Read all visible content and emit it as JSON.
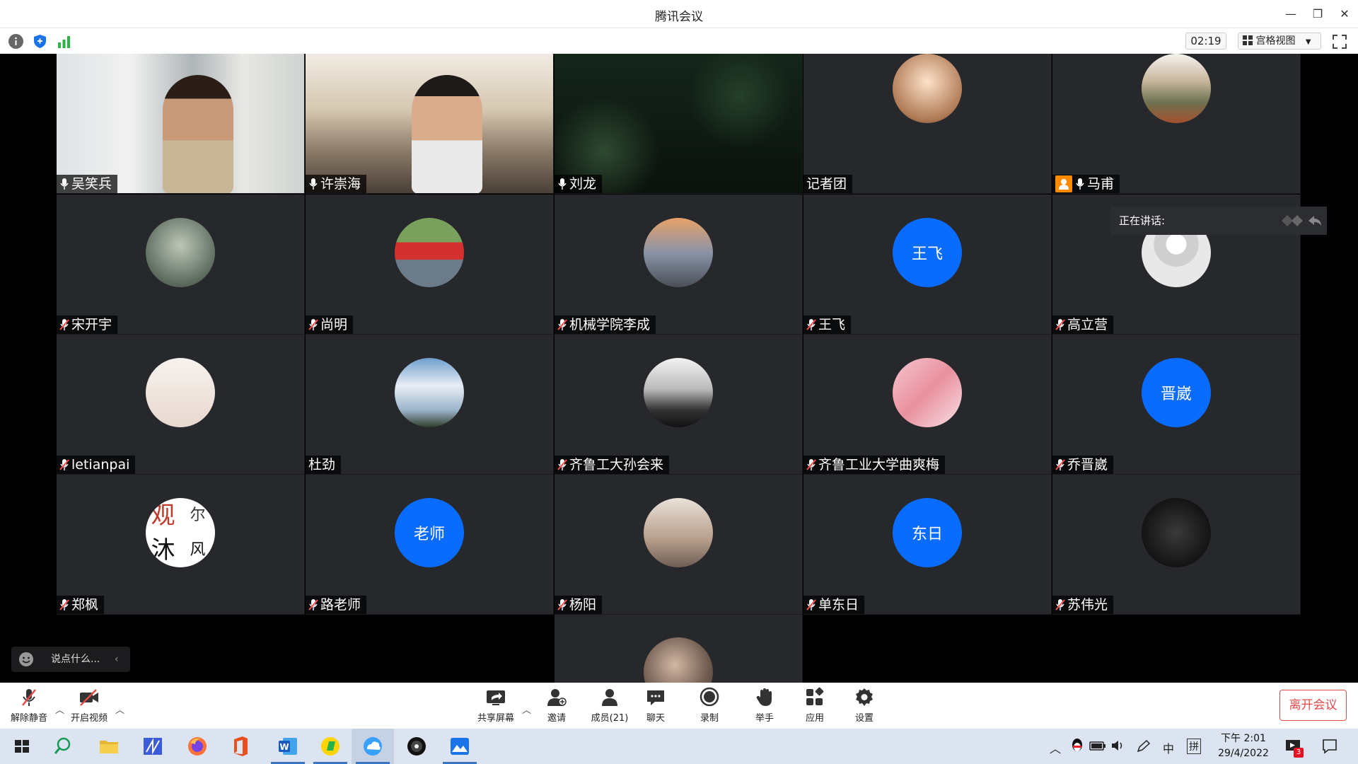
{
  "window": {
    "title": "腾讯会议",
    "minimize_glyph": "—",
    "restore_glyph": "❐",
    "close_glyph": "✕"
  },
  "topbar": {
    "timer": "02:19",
    "view_label": "宫格视图",
    "icons": [
      "info-icon",
      "shield-icon",
      "signal-icon",
      "grid-icon",
      "fullscreen-icon"
    ]
  },
  "participants": [
    {
      "name": "吴笑兵",
      "mic": "on"
    },
    {
      "name": "许崇海",
      "mic": "on"
    },
    {
      "name": "刘龙",
      "mic": "on"
    },
    {
      "name": "记者团",
      "mic": "none"
    },
    {
      "name": "马甫",
      "mic": "on",
      "host": true
    },
    {
      "name": "宋开宇",
      "mic": "muted"
    },
    {
      "name": "尚明",
      "mic": "muted"
    },
    {
      "name": "机械学院李成",
      "mic": "muted"
    },
    {
      "name": "王飞",
      "mic": "muted",
      "avatar_text": "王飞"
    },
    {
      "name": "高立营",
      "mic": "muted"
    },
    {
      "name": "letianpai",
      "mic": "muted"
    },
    {
      "name": "杜劲",
      "mic": "none"
    },
    {
      "name": "齐鲁工大孙会来",
      "mic": "muted"
    },
    {
      "name": "齐鲁工业大学曲爽梅",
      "mic": "muted"
    },
    {
      "name": "乔晋崴",
      "mic": "muted",
      "avatar_text": "晋崴"
    },
    {
      "name": "郑枫",
      "mic": "muted",
      "avatar_text_lines": [
        "观",
        "尔",
        "沐",
        "风"
      ]
    },
    {
      "name": "路老师",
      "mic": "muted",
      "avatar_text": "老师"
    },
    {
      "name": "杨阳",
      "mic": "muted"
    },
    {
      "name": "单东日",
      "mic": "muted",
      "avatar_text": "东日"
    },
    {
      "name": "苏伟光",
      "mic": "muted"
    }
  ],
  "speaking_label": "正在讲话:",
  "chat_placeholder": "说点什么...",
  "controls": {
    "unmute": "解除静音",
    "start_video": "开启视频",
    "share_screen": "共享屏幕",
    "invite": "邀请",
    "members": "成员(21)",
    "chat": "聊天",
    "record": "录制",
    "raise_hand": "举手",
    "apps": "应用",
    "settings": "设置",
    "leave": "离开会议"
  },
  "taskbar": {
    "clock_time": "下午 2:01",
    "clock_date": "29/4/2022",
    "ime_lang": "中",
    "ime_mode": "拼",
    "notification_count": "3"
  },
  "colors": {
    "tile_bg": "#27282b",
    "avatar_blue": "#0a6cff",
    "leave_red": "#e34b4b",
    "muted_red": "#ff4d4f",
    "taskbar_bg": "#dbe4f0"
  }
}
